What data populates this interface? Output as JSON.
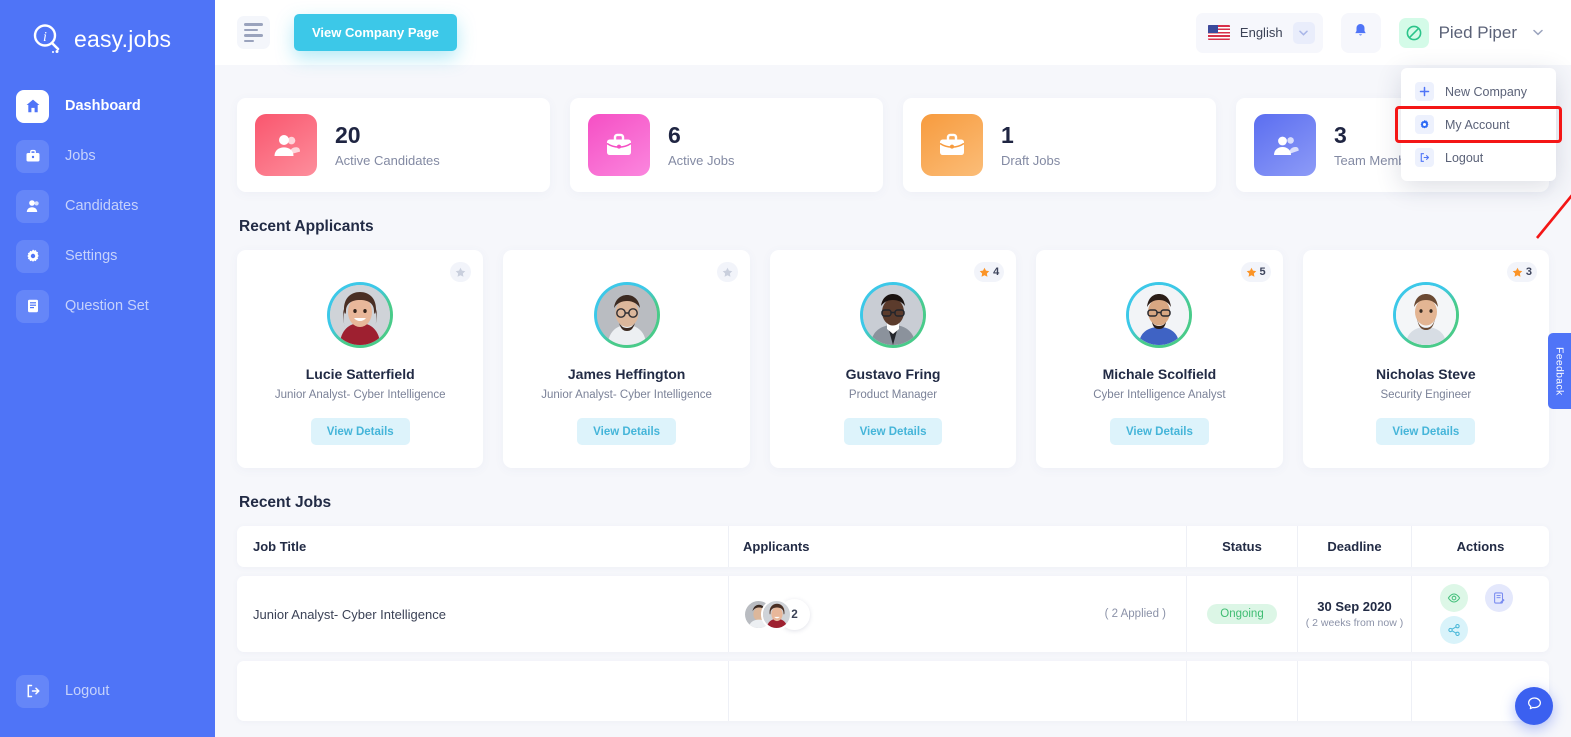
{
  "brand": {
    "name": "easy.jobs",
    "logo_icon": "magnifier-logo-icon"
  },
  "sidebar": {
    "items": [
      {
        "label": "Dashboard",
        "icon": "home-icon",
        "active": true
      },
      {
        "label": "Jobs",
        "icon": "briefcase-icon",
        "active": false
      },
      {
        "label": "Candidates",
        "icon": "user-icon",
        "active": false
      },
      {
        "label": "Settings",
        "icon": "gear-icon",
        "active": false
      },
      {
        "label": "Question Set",
        "icon": "clipboard-icon",
        "active": false
      }
    ],
    "logout": {
      "label": "Logout",
      "icon": "logout-icon"
    }
  },
  "topbar": {
    "menu_icon": "hamburger-icon",
    "view_company_label": "View Company Page",
    "language": {
      "value": "English",
      "flag": "us-flag-icon",
      "chevron": "chevron-down-icon"
    },
    "notification_icon": "bell-icon",
    "user": {
      "name": "Pied Piper",
      "avatar_icon": "slash-circle-icon",
      "chevron": "chevron-down-icon"
    }
  },
  "user_dropdown": {
    "items": [
      {
        "label": "New Company",
        "icon": "plus-icon",
        "highlighted": false
      },
      {
        "label": "My Account",
        "icon": "gear-icon",
        "highlighted": true
      },
      {
        "label": "Logout",
        "icon": "logout-icon",
        "highlighted": false
      }
    ]
  },
  "stats": [
    {
      "value": "20",
      "label": "Active Candidates",
      "icon": "users-icon",
      "color": "#f9566e"
    },
    {
      "value": "6",
      "label": "Active Jobs",
      "icon": "briefcase-icon",
      "color": "#f54fc4"
    },
    {
      "value": "1",
      "label": "Draft Jobs",
      "icon": "briefcase-icon",
      "color": "#f7a650"
    },
    {
      "value": "3",
      "label": "Team Members",
      "icon": "team-icon",
      "color": "#6b7cf0"
    }
  ],
  "recent_applicants": {
    "title": "Recent Applicants",
    "cards": [
      {
        "name": "Lucie Satterfield",
        "role": "Junior Analyst- Cyber Intelligence",
        "rating": "",
        "starred": false,
        "button": "View Details",
        "skin": "#e8b79a",
        "hair": "#4a2f24",
        "bg": "#cfd3d8",
        "cloth": "#9e2030"
      },
      {
        "name": "James Heffington",
        "role": "Junior Analyst- Cyber Intelligence",
        "rating": "",
        "starred": false,
        "button": "View Details",
        "skin": "#dcb79b",
        "hair": "#3c2a21",
        "bg": "#b9bcc1",
        "cloth": "#eceff2"
      },
      {
        "name": "Gustavo Fring",
        "role": "Product Manager",
        "rating": "4",
        "starred": true,
        "button": "View Details",
        "skin": "#5b3b2c",
        "hair": "#1a1210",
        "bg": "#c9cdd4",
        "cloth": "#8b929c"
      },
      {
        "name": "Michale Scolfield",
        "role": "Cyber Intelligence Analyst",
        "rating": "5",
        "starred": true,
        "button": "View Details",
        "skin": "#d8a782",
        "hair": "#2b1d17",
        "bg": "#f2f4f7",
        "cloth": "#3f63c4"
      },
      {
        "name": "Nicholas Steve",
        "role": "Security Engineer",
        "rating": "3",
        "starred": true,
        "button": "View Details",
        "skin": "#e3b593",
        "hair": "#6b4a33",
        "bg": "#f4f6f8",
        "cloth": "#d7dde4"
      }
    ]
  },
  "recent_jobs": {
    "title": "Recent Jobs",
    "columns": [
      "Job Title",
      "Applicants",
      "Status",
      "Deadline",
      "Actions"
    ],
    "rows": [
      {
        "job_title": "Junior Analyst- Cyber Intelligence",
        "applicant_count": "2",
        "applied_text": "( 2 Applied )",
        "status": "Ongoing",
        "deadline_date": "30 Sep 2020",
        "deadline_sub": "( 2 weeks from now )",
        "actions": [
          "view-icon",
          "edit-icon",
          "share-icon"
        ]
      }
    ]
  },
  "feedback_tab": {
    "label": "Feedback"
  },
  "chat_button": {
    "icon": "chat-bubble-icon"
  },
  "colors": {
    "sidebar_bg": "#4f74f7",
    "accent_cyan": "#3cc8e8",
    "page_bg": "#f6f7fb",
    "status_green": "#3fbd72",
    "highlight_red": "#f41616"
  }
}
